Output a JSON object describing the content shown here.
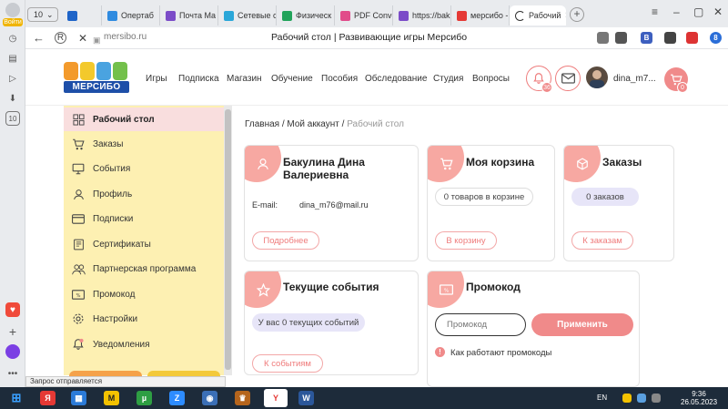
{
  "browser": {
    "login_label": "Войти",
    "tab_count": "10",
    "tabs": [
      {
        "label": "",
        "color": "#1e64c8"
      },
      {
        "label": "Опертаб",
        "color": "#2f8be0"
      },
      {
        "label": "Почта Ma",
        "color": "#7b4cc8"
      },
      {
        "label": "Сетевые с",
        "color": "#2aa7d9"
      },
      {
        "label": "Физическ",
        "color": "#21a35a"
      },
      {
        "label": "PDF Conve",
        "color": "#e14b8a"
      },
      {
        "label": "https://bak",
        "color": "#7b4cc8"
      },
      {
        "label": "мерсибо -",
        "color": "#e53935"
      },
      {
        "label": "Рабочий",
        "color": "#333333"
      }
    ],
    "new_tab_symbol": "+",
    "url": "mersibo.ru",
    "page_title": "Рабочий стол | Развивающие игры Мерсибо",
    "ext_badges": [
      "B",
      "8"
    ],
    "status_text": "Запрос отправляется"
  },
  "header": {
    "logo_text": "МЕРСИБО",
    "menu": [
      "Игры",
      "Подписка",
      "Магазин",
      "Обучение",
      "Пособия",
      "Обследование",
      "Студия",
      "Вопросы"
    ],
    "notif_badge": "36",
    "user_name": "dina_m7...",
    "cart_badge": "0"
  },
  "sidebar": {
    "items": [
      {
        "label": "Рабочий стол",
        "icon": "grid-icon"
      },
      {
        "label": "Заказы",
        "icon": "cart-icon"
      },
      {
        "label": "События",
        "icon": "monitor-icon"
      },
      {
        "label": "Профиль",
        "icon": "user-icon"
      },
      {
        "label": "Подписки",
        "icon": "card-icon"
      },
      {
        "label": "Сертификаты",
        "icon": "certificate-icon"
      },
      {
        "label": "Партнерская программа",
        "icon": "partners-icon"
      },
      {
        "label": "Промокод",
        "icon": "promo-icon"
      },
      {
        "label": "Настройки",
        "icon": "gear-icon"
      },
      {
        "label": "Уведомления",
        "icon": "bell-icon"
      }
    ]
  },
  "breadcrumb": {
    "home": "Главная",
    "sep": " / ",
    "account": "Мой аккаунт",
    "current": "Рабочий стол"
  },
  "cards": {
    "profile": {
      "title": "Бакулина Дина Валериевна",
      "email_label": "E-mail:",
      "email": "dina_m76@mail.ru",
      "button": "Подробнее"
    },
    "basket": {
      "title": "Моя корзина",
      "info": "0 товаров в корзине",
      "button": "В корзину"
    },
    "orders": {
      "title": "Заказы",
      "info": "0 заказов",
      "button": "К заказам"
    },
    "events": {
      "title": "Текущие события",
      "info": "У вас 0 текущих событий",
      "button": "К событиям"
    },
    "promo": {
      "title": "Промокод",
      "placeholder": "Промокод",
      "apply": "Применить",
      "help": "Как работают промокоды"
    }
  },
  "taskbar": {
    "lang": "EN",
    "time": "9:36",
    "date": "26.05.2023"
  },
  "colors": {
    "accent": "#f08a8a",
    "sidebar_bg": "#fdf0b2",
    "card_corner": "#f7a8a2"
  }
}
